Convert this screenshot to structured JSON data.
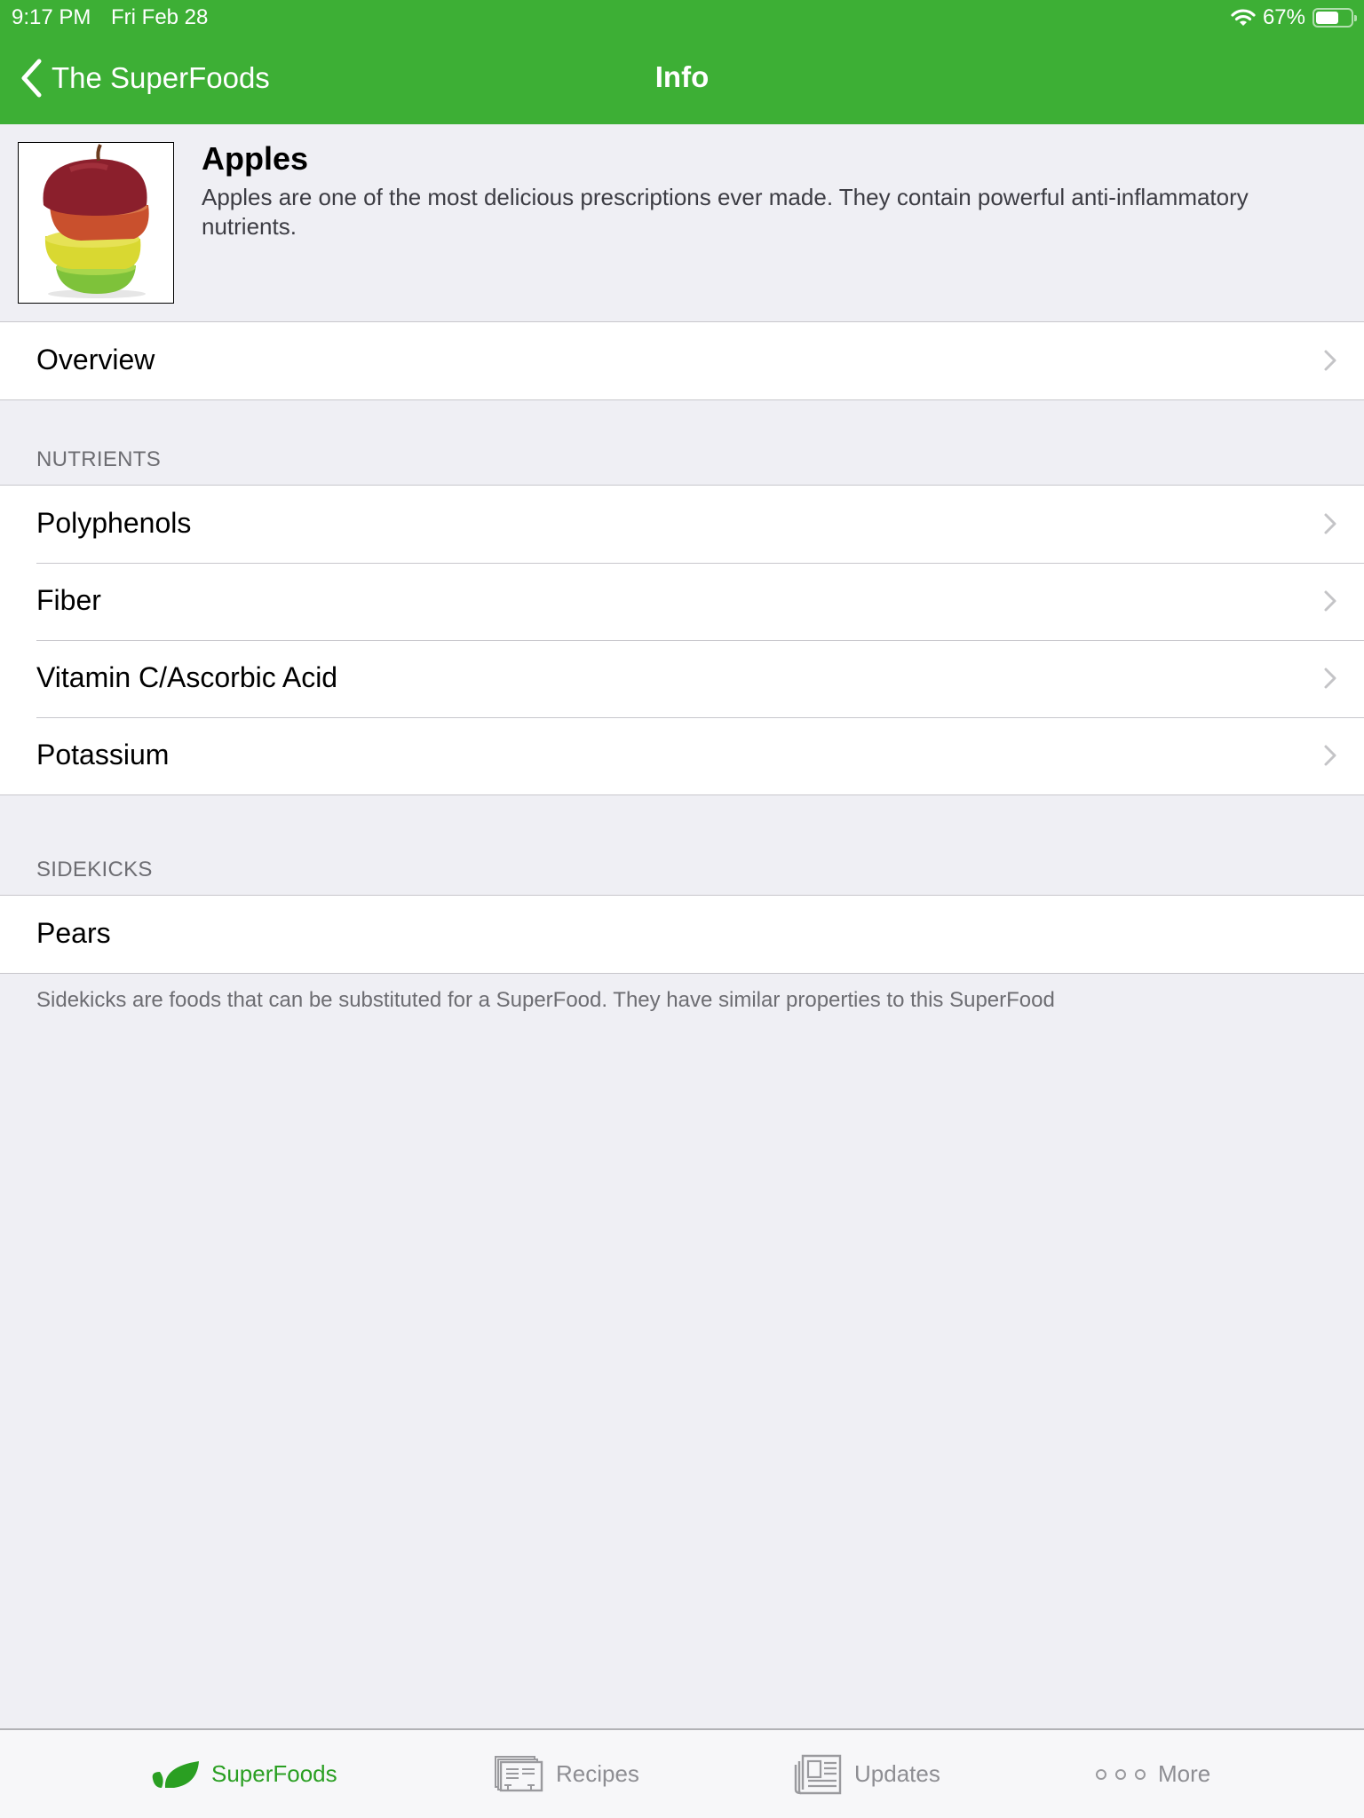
{
  "status_bar": {
    "time": "9:17 PM",
    "date": "Fri Feb 28",
    "battery_percent_label": "67%",
    "battery_level": 0.67,
    "wifi_icon": "wifi-icon"
  },
  "nav": {
    "back_label": "The SuperFoods",
    "title": "Info",
    "color": "#3daf35"
  },
  "food": {
    "name": "Apples",
    "description": "Apples are one of the most delicious prescriptions ever made. They contain powerful anti-inflammatory nutrients.",
    "image": "apple-slices-image"
  },
  "overview": {
    "label": "Overview"
  },
  "nutrients": {
    "header": "NUTRIENTS",
    "items": [
      {
        "label": "Polyphenols"
      },
      {
        "label": "Fiber"
      },
      {
        "label": "Vitamin C/Ascorbic Acid"
      },
      {
        "label": "Potassium"
      }
    ]
  },
  "sidekicks": {
    "header": "SIDEKICKS",
    "items": [
      {
        "label": "Pears"
      }
    ],
    "footer": "Sidekicks are foods that can be substituted for a SuperFood. They have similar properties to this SuperFood"
  },
  "tabbar": {
    "active_color": "#2a9f22",
    "inactive_color": "#8e8e93",
    "tabs": [
      {
        "label": "SuperFoods",
        "icon": "leaf-icon",
        "active": true
      },
      {
        "label": "Recipes",
        "icon": "recipe-cards-icon",
        "active": false
      },
      {
        "label": "Updates",
        "icon": "newspaper-icon",
        "active": false
      },
      {
        "label": "More",
        "icon": "more-dots-icon",
        "active": false
      }
    ]
  }
}
